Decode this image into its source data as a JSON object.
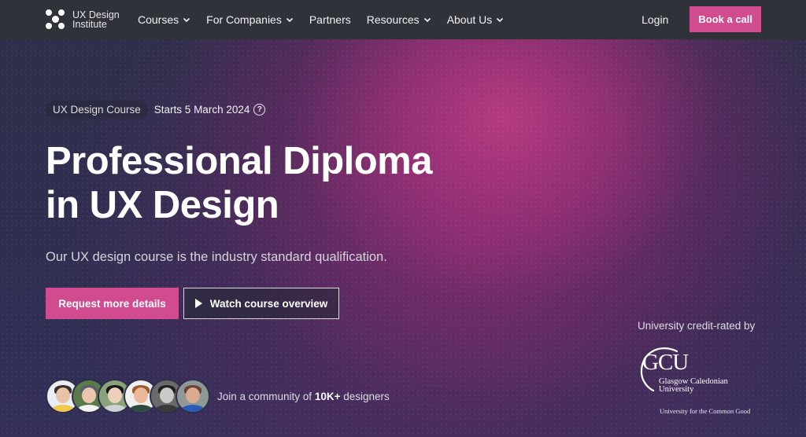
{
  "brand": {
    "logo_line1": "UX Design",
    "logo_line2": "Institute"
  },
  "nav": {
    "items": [
      {
        "label": "Courses",
        "has_dropdown": true
      },
      {
        "label": "For Companies",
        "has_dropdown": true
      },
      {
        "label": "Partners",
        "has_dropdown": false
      },
      {
        "label": "Resources",
        "has_dropdown": true
      },
      {
        "label": "About Us",
        "has_dropdown": true
      }
    ],
    "login_label": "Login",
    "book_call_label": "Book a call"
  },
  "hero": {
    "course_pill": "UX Design Course",
    "start_date": "Starts 5 March 2024",
    "help_icon": "question-circle-icon",
    "title_line1": "Professional Diploma",
    "title_line2": "in UX Design",
    "subtitle": "Our UX design course is the industry standard qualification.",
    "primary_cta": "Request more details",
    "secondary_cta": "Watch course overview",
    "secondary_cta_icon": "play-icon",
    "community_prefix": "Join a community of ",
    "community_count": "10K+",
    "community_suffix": " designers",
    "avatar_count": 6
  },
  "accreditation": {
    "label": "University credit-rated by",
    "logo_text": "GCU",
    "university_line1": "Glasgow Caledonian",
    "university_line2": "University",
    "tagline": "University for the Common Good"
  },
  "colors": {
    "accent": "#d14b8f",
    "navbar_bg": "#2f3239",
    "hero_dark": "#2d2f4b",
    "hero_magenta": "#ba3a82"
  }
}
